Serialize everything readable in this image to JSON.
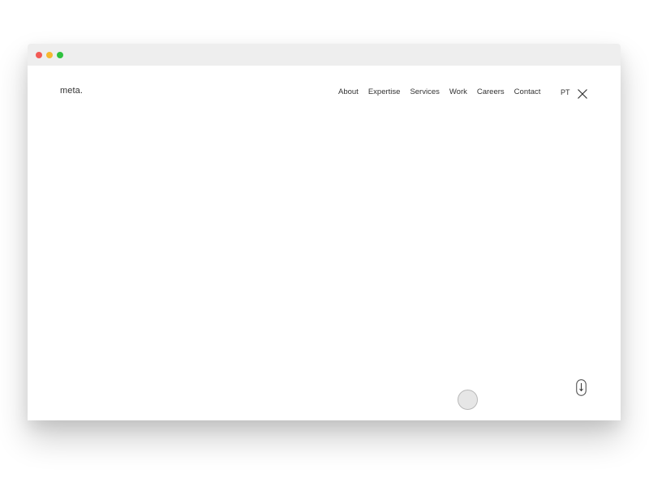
{
  "window": {
    "traffic_lights": [
      {
        "name": "close",
        "color": "#f25a55"
      },
      {
        "name": "minimize",
        "color": "#f6b82f"
      },
      {
        "name": "zoom",
        "color": "#2ec13f"
      }
    ]
  },
  "header": {
    "logo": "meta.",
    "nav": [
      {
        "label": "About"
      },
      {
        "label": "Expertise"
      },
      {
        "label": "Services"
      },
      {
        "label": "Work"
      },
      {
        "label": "Careers"
      },
      {
        "label": "Contact"
      }
    ],
    "language": "PT",
    "close_icon": "close-x-icon"
  },
  "main": {
    "circle_button_icon": "circle-icon",
    "scroll_indicator_icon": "scroll-down-mouse-icon"
  }
}
